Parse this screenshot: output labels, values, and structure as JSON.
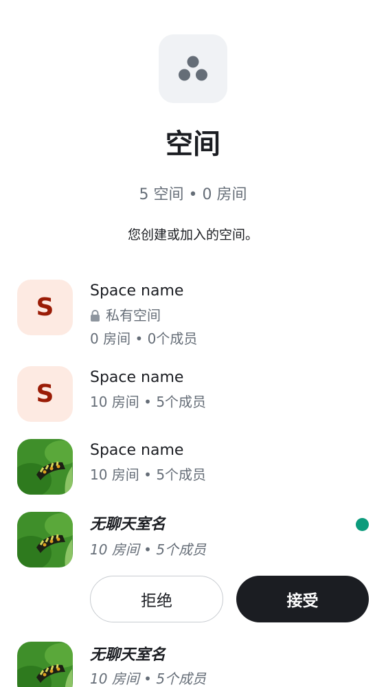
{
  "header": {
    "icon": "spaces-icon",
    "title": "空间",
    "counts": "5 空间 • 0 房间",
    "description": "您创建或加入的空间。"
  },
  "spaces": [
    {
      "avatar_type": "letter",
      "avatar_letter": "S",
      "name": "Space name",
      "visibility": "私有空间",
      "stats": "0 房间 • 0个成员"
    },
    {
      "avatar_type": "letter",
      "avatar_letter": "S",
      "name": "Space name",
      "stats": "10 房间 • 5个成员"
    },
    {
      "avatar_type": "image",
      "name": "Space name",
      "stats": "10 房间 • 5个成员"
    },
    {
      "avatar_type": "image",
      "name": "无聊天室名",
      "stats": "10 房间 • 5个成员",
      "unread": true,
      "invite": {
        "decline_label": "拒绝",
        "accept_label": "接受"
      }
    },
    {
      "avatar_type": "image",
      "name": "无聊天室名",
      "stats": "10 房间 • 5个成员"
    }
  ],
  "colors": {
    "avatar_letter_bg": "#fdeae2",
    "avatar_letter_fg": "#9a1c06",
    "unread_dot": "#0c9b7c",
    "accept_bg": "#1b1d22",
    "secondary_text": "#656d77"
  }
}
